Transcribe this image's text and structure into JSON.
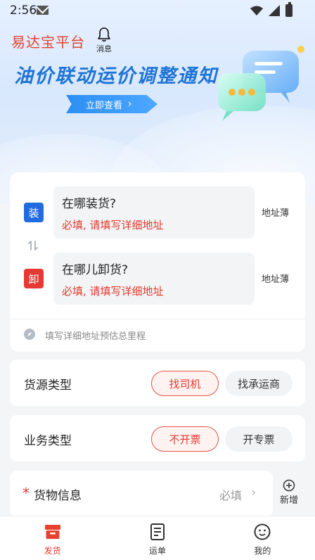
{
  "status_bar": {
    "time": "2:56"
  },
  "header": {
    "brand": "易达宝平台",
    "notice_label": "消息"
  },
  "banner": {
    "title": "油价联动运价调整通知",
    "button_label": "立即查看"
  },
  "address": {
    "load_tag": "装",
    "unload_tag": "卸",
    "load_question": "在哪装货?",
    "load_error": "必填, 请填写详细地址",
    "unload_question": "在哪儿卸货?",
    "unload_error": "必填, 请填写详细地址",
    "address_book": "地址薄",
    "mileage_hint": "填写详细地址预估总里程"
  },
  "source_type": {
    "label": "货源类型",
    "options": [
      "找司机",
      "找承运商"
    ],
    "selected": "找司机"
  },
  "business_type": {
    "label": "业务类型",
    "options": [
      "不开票",
      "开专票"
    ],
    "selected": "不开票"
  },
  "goods": {
    "required_mark": "*",
    "label": "货物信息",
    "required_text": "必填",
    "add_label": "新增"
  },
  "bottom_nav": [
    {
      "label": "发货",
      "icon": "ship-box-icon",
      "active": true
    },
    {
      "label": "运单",
      "icon": "waybill-icon",
      "active": false
    },
    {
      "label": "我的",
      "icon": "profile-face-icon",
      "active": false
    }
  ],
  "colors": {
    "brand_red": "#e23a2e",
    "banner_blue": "#1f74d6",
    "load_blue": "#1f6bdf"
  }
}
